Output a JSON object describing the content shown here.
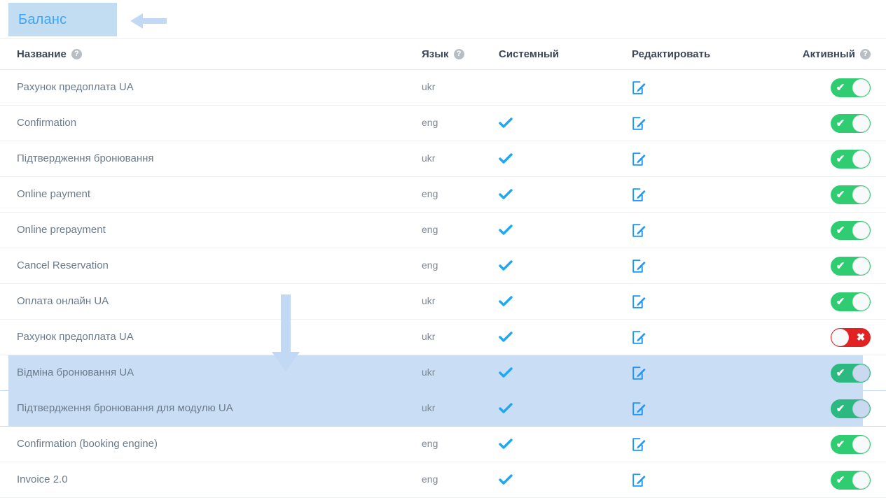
{
  "tab": {
    "label": "Баланс"
  },
  "annotations": {
    "left_arrow": "left-arrow-annotation",
    "down_arrow": "down-arrow-annotation",
    "color": "#c2d9f5"
  },
  "table": {
    "columns": [
      {
        "label": "Название",
        "help": "?",
        "has_help": true
      },
      {
        "label": "Язык",
        "help": "?",
        "has_help": true
      },
      {
        "label": "Системный",
        "help": "",
        "has_help": false
      },
      {
        "label": "Редактировать",
        "help": "",
        "has_help": false
      },
      {
        "label": "Активный",
        "help": "?",
        "has_help": true
      }
    ],
    "icons": {
      "help": "help-circle-icon",
      "check": "check-icon",
      "edit": "edit-pencil-icon",
      "toggle_on_glyph": "✔",
      "toggle_off_glyph": "✖"
    },
    "colors": {
      "toggle_on": "#2fcc71",
      "toggle_off": "#e22222",
      "check": "#1ea7f2",
      "edit": "#2196f3",
      "row_highlight": "#c9ddf5",
      "tab_bg": "#c2ddf2",
      "tab_text": "#3da5f4"
    },
    "rows": [
      {
        "name": "Рахунок предоплата UA",
        "lang": "ukr",
        "system": false,
        "active": true,
        "highlight": false
      },
      {
        "name": "Confirmation",
        "lang": "eng",
        "system": true,
        "active": true,
        "highlight": false
      },
      {
        "name": "Підтвердження бронювання",
        "lang": "ukr",
        "system": true,
        "active": true,
        "highlight": false
      },
      {
        "name": "Online payment",
        "lang": "eng",
        "system": true,
        "active": true,
        "highlight": false
      },
      {
        "name": "Online prepayment",
        "lang": "eng",
        "system": true,
        "active": true,
        "highlight": false
      },
      {
        "name": "Cancel Reservation",
        "lang": "eng",
        "system": true,
        "active": true,
        "highlight": false
      },
      {
        "name": "Оплата онлайн UA",
        "lang": "ukr",
        "system": true,
        "active": true,
        "highlight": false
      },
      {
        "name": "Рахунок предоплата UA",
        "lang": "ukr",
        "system": true,
        "active": false,
        "highlight": false
      },
      {
        "name": "Відміна бронювання UA",
        "lang": "ukr",
        "system": true,
        "active": true,
        "highlight": true
      },
      {
        "name": "Підтвердження бронювання для модулю UA",
        "lang": "ukr",
        "system": true,
        "active": true,
        "highlight": true
      },
      {
        "name": "Confirmation (booking engine)",
        "lang": "eng",
        "system": true,
        "active": true,
        "highlight": false
      },
      {
        "name": "Invoice 2.0",
        "lang": "eng",
        "system": true,
        "active": true,
        "highlight": false
      }
    ]
  }
}
